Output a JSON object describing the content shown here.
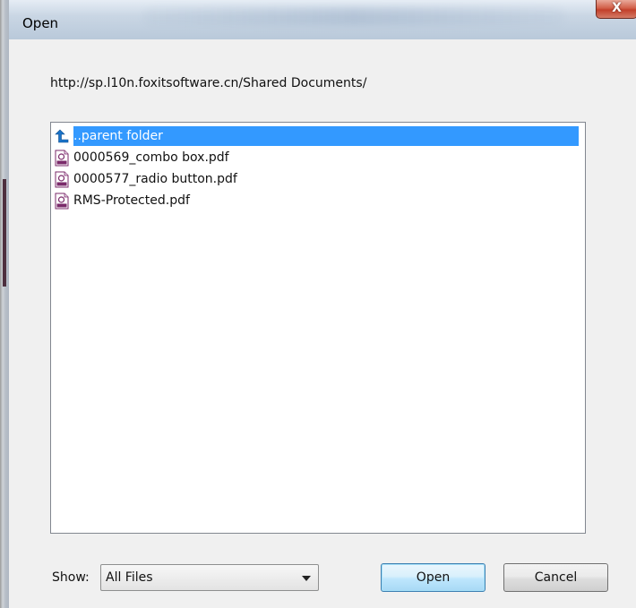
{
  "window": {
    "title": "Open",
    "close_glyph": "X"
  },
  "location": {
    "path": "http://sp.l10n.foxitsoftware.cn/Shared Documents/"
  },
  "file_list": {
    "items": [
      {
        "label": "..parent folder",
        "icon": "up-arrow-icon",
        "selected": true
      },
      {
        "label": "0000569_combo box.pdf",
        "icon": "pdf-file-icon",
        "selected": false
      },
      {
        "label": "0000577_radio button.pdf",
        "icon": "pdf-file-icon",
        "selected": false
      },
      {
        "label": "RMS-Protected.pdf",
        "icon": "pdf-file-icon",
        "selected": false
      }
    ]
  },
  "filter": {
    "label": "Show:",
    "selected_value": "All Files"
  },
  "buttons": {
    "open_label": "Open",
    "cancel_label": "Cancel"
  },
  "colors": {
    "selection": "#3399ff",
    "close_button": "#c2402b",
    "icon_blue": "#1a73c9",
    "pdf_icon_purple": "#7a2a6a"
  }
}
